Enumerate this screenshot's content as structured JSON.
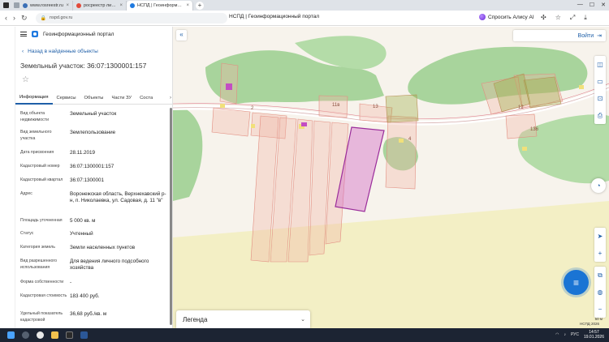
{
  "browser": {
    "tabs": [
      {
        "label": "www.rosreestr.ru",
        "favicon_color": "#3b6fb6",
        "active": false
      },
      {
        "label": "росреестр личный кабинет",
        "favicon_color": "#e24a3a",
        "active": false
      },
      {
        "label": "НСПД | Геоинформационный портал",
        "favicon_color": "#1f7ae0",
        "active": true
      }
    ],
    "url": "nspd.gov.ru",
    "page_title": "НСПД | Геоинформационный портал",
    "alice_label": "Спросить Алису AI"
  },
  "panel": {
    "portal_name": "Геоинформационный портал",
    "back_label": "Назад в найденные объекты",
    "object_title": "Земельный участок: 36:07:1300001:157",
    "tabs": [
      "Информация",
      "Сервисы",
      "Объекты",
      "Части ЗУ",
      "Соста"
    ],
    "properties": [
      {
        "key": "Вид объекта недвижимости",
        "value": "Земельный участок"
      },
      {
        "key": "Вид земельного участка",
        "value": "Землепользование"
      },
      {
        "key": "Дата присвоения",
        "value": "28.11.2019"
      },
      {
        "key": "Кадастровый номер",
        "value": "36:07:1300001:157"
      },
      {
        "key": "Кадастровый квартал",
        "value": "36:07:1300001"
      },
      {
        "key": "Адрес",
        "value": "Воронежская область, Верхнехавский р-н, п. Николаевка, ул. Садовая, д. 11 \"в\""
      },
      {
        "key": "Площадь уточненная",
        "value": "5 000 кв. м"
      },
      {
        "key": "Статус",
        "value": "Учтенный"
      },
      {
        "key": "Категория земель",
        "value": "Земли населенных пунктов"
      },
      {
        "key": "Вид разрешенного использования",
        "value": "Для ведения личного подсобного хозяйства"
      },
      {
        "key": "Форма собственности",
        "value": "-"
      },
      {
        "key": "Кадастровая стоимость",
        "value": "183 400 руб."
      },
      {
        "key": "Удельный показатель кадастровой",
        "value": "36,68 руб./кв. м"
      }
    ]
  },
  "map": {
    "login_label": "Войти",
    "legend_label": "Легенда",
    "labels": [
      "11в",
      "13",
      "12",
      "136",
      "2",
      "4"
    ],
    "attribution": "НСПД 2026",
    "scale": "50 м"
  },
  "taskbar": {
    "lang": "РУС",
    "time": "14:57",
    "date": "19.01.2026"
  }
}
